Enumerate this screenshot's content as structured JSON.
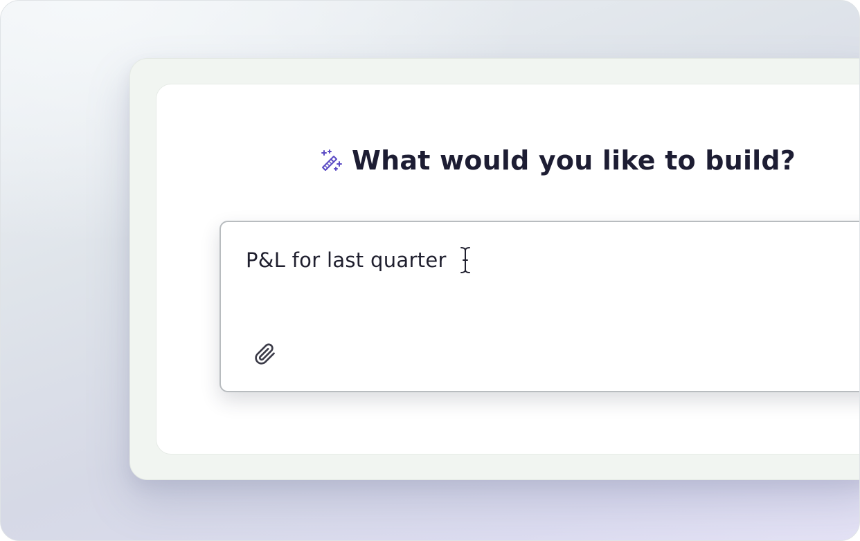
{
  "heading": {
    "title": "What would you like to build?",
    "icon": "magic-wand-icon",
    "icon_color": "#5b4bc4"
  },
  "prompt": {
    "value": "P&L for last quarter",
    "cursor_icon": "text-cursor-icon",
    "attach_icon": "paperclip-icon"
  }
}
